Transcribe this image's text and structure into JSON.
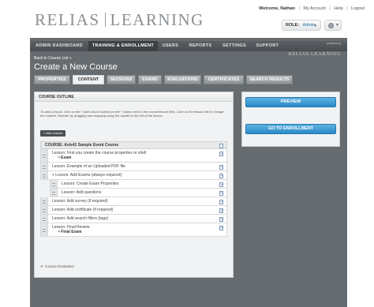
{
  "header": {
    "logo_left": "RELIAS",
    "logo_right": "LEARNING",
    "welcome": "Welcome, Nathan",
    "links": [
      "My Account",
      "Help",
      "Logout"
    ],
    "role_label": "ROLE:",
    "role_value": "Admin"
  },
  "nav": {
    "items": [
      "ADMIN DASHBOARD",
      "TRAINING & ENROLLMENT",
      "USERS",
      "REPORTS",
      "SETTINGS",
      "SUPPORT"
    ],
    "active": "TRAINING & ENROLLMENT",
    "powered_by": "powered by",
    "powered_logo": "RELIAS LEARNING"
  },
  "page": {
    "back_link": "Back to Course List »",
    "title": "Create a New Course"
  },
  "tabs": [
    "PROPERTIES",
    "CONTENT",
    "SESSIONS",
    "EXAMS",
    "EVALUATIONS",
    "CERTIFICATES",
    "SEARCH RESULTS"
  ],
  "active_tab": "CONTENT",
  "outline": {
    "header": "COURSE OUTLINE",
    "instructions": "To add a lesson, click on the + Add Lesson button (or the + button next to the course/lesson title). Click on the lesson title to change the content. Reorder by dragging and dropping using the handle to the left of the lesson.",
    "add_lesson": "+ Add Lesson",
    "course_title": "COURSE: Axis41 Sample Event Course",
    "rows": [
      {
        "text": "Lesson: First you create the course properties or shell",
        "sub": "• Exam"
      },
      {
        "text": "Lesson: Example of an Uploaded PDF file"
      },
      {
        "text": "+ Lesson: Add Exams (always required)"
      },
      {
        "text": "Lesson: Create Exam Properties"
      },
      {
        "text": "Lesson: Add questions"
      },
      {
        "text": "Lesson: Add survey (if required)"
      },
      {
        "text": "Lesson: Add certificate (if required)"
      },
      {
        "text": "Lesson: Add search fillers (tags)"
      },
      {
        "text": "Lesson: Final Review",
        "sub": "• Final Exam"
      }
    ],
    "evaluation": "Course Evaluation"
  },
  "actions": {
    "preview": "PREVIEW",
    "goto_enrollment": "GO TO ENROLLMENT"
  },
  "colors": {
    "nav_bg": "#4a4e52",
    "page_bg": "#666b6f",
    "button_blue": "#2a8ac6"
  }
}
